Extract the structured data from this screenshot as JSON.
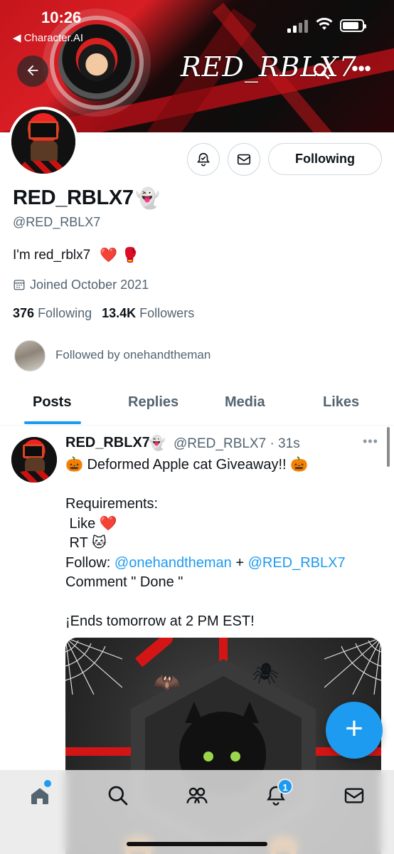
{
  "status_bar": {
    "time": "10:26",
    "back_app_label": "◀ Character.AI"
  },
  "banner": {
    "title": "RED_RBLX7"
  },
  "header": {
    "back_icon": "arrow-left-icon",
    "search_icon": "search-icon",
    "more_icon": "more-icon"
  },
  "profile": {
    "display_name": "RED_RBLX7",
    "name_emoji": "👻",
    "handle": "@RED_RBLX7",
    "bio": "I'm red_rblx7",
    "bio_emoji": "❤️ 🥊",
    "joined": "Joined October 2021",
    "following_count": "376",
    "following_label": "Following",
    "followers_count": "13.4K",
    "followers_label": "Followers",
    "followed_by": "Followed by onehandtheman"
  },
  "actions": {
    "following_label": "Following"
  },
  "tabs": [
    {
      "label": "Posts",
      "active": true
    },
    {
      "label": "Replies",
      "active": false
    },
    {
      "label": "Media",
      "active": false
    },
    {
      "label": "Likes",
      "active": false
    }
  ],
  "post": {
    "name": "RED_RBLX7",
    "name_emoji": "👻",
    "meta": "@RED_RBLX7 · 31s",
    "more": "•••",
    "lines": {
      "l1": "🎃 Deformed Apple cat Giveaway!! 🎃",
      "l2": "",
      "l3": "Requirements:",
      "l4": " Like ❤️",
      "l5": " RT 🐱",
      "l6_prefix": "Follow: ",
      "l6_link1": "@onehandtheman",
      "l6_mid": " + ",
      "l6_link2": "@RED_RBLX7",
      "l7": "Comment \" Done \"",
      "l8": "",
      "l9": "¡Ends tomorrow at 2 PM EST!"
    }
  },
  "fab": {
    "label": "+"
  },
  "bottom_nav": {
    "notifications_badge": "1"
  },
  "colors": {
    "accent": "#1d9bf0",
    "banner_red": "#c4161c",
    "text_secondary": "#536471"
  }
}
